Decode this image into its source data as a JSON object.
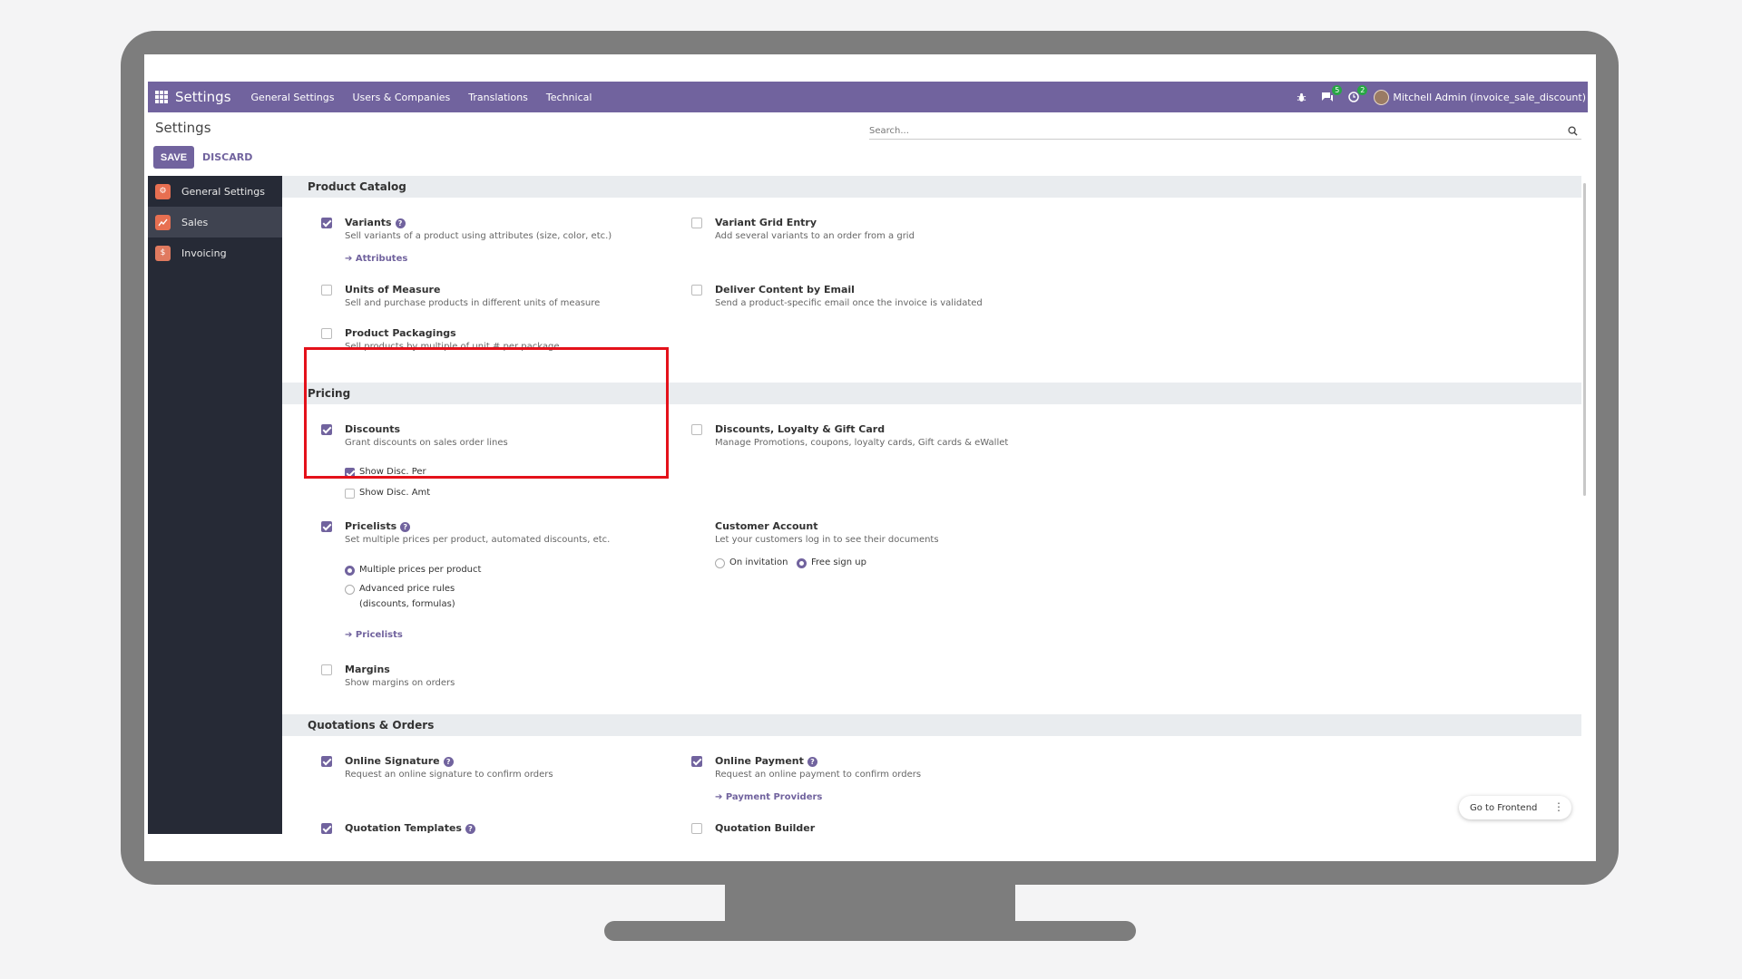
{
  "navbar": {
    "brand": "Settings",
    "items": [
      "General Settings",
      "Users & Companies",
      "Translations",
      "Technical"
    ],
    "messages_count": "5",
    "activities_count": "2",
    "user": "Mitchell Admin (invoice_sale_discount)"
  },
  "control_panel": {
    "title": "Settings",
    "save_label": "SAVE",
    "discard_label": "DISCARD",
    "search_placeholder": "Search..."
  },
  "sidebar": {
    "items": [
      {
        "label": "General Settings",
        "color": "#e76f51",
        "active": false
      },
      {
        "label": "Sales",
        "color": "#e76f51",
        "active": true
      },
      {
        "label": "Invoicing",
        "color": "#e07a5f",
        "active": false
      }
    ]
  },
  "sections": {
    "product_catalog": "Product Catalog",
    "pricing": "Pricing",
    "quotations_orders": "Quotations & Orders"
  },
  "settings": {
    "variants": {
      "title": "Variants",
      "desc": "Sell variants of a product using attributes (size, color, etc.)",
      "link": "Attributes",
      "checked": true
    },
    "variant_grid": {
      "title": "Variant Grid Entry",
      "desc": "Add several variants to an order from a grid",
      "checked": false
    },
    "uom": {
      "title": "Units of Measure",
      "desc": "Sell and purchase products in different units of measure",
      "checked": false
    },
    "deliver_content": {
      "title": "Deliver Content by Email",
      "desc": "Send a product-specific email once the invoice is validated",
      "checked": false
    },
    "packagings": {
      "title": "Product Packagings",
      "desc": "Sell products by multiple of unit # per package",
      "checked": false
    },
    "discounts": {
      "title": "Discounts",
      "desc": "Grant discounts on sales order lines",
      "checked": true,
      "show_disc_per": "Show Disc. Per",
      "show_disc_amt": "Show Disc. Amt"
    },
    "loyalty": {
      "title": "Discounts, Loyalty & Gift Card",
      "desc": "Manage Promotions, coupons, loyalty cards, Gift cards & eWallet",
      "checked": false
    },
    "pricelists": {
      "title": "Pricelists",
      "desc": "Set multiple prices per product, automated discounts, etc.",
      "checked": true,
      "option_multiple": "Multiple prices per product",
      "option_advanced": "Advanced price rules",
      "option_advanced_sub": "(discounts, formulas)",
      "link": "Pricelists"
    },
    "customer_account": {
      "title": "Customer Account",
      "desc": "Let your customers log in to see their documents",
      "option_invitation": "On invitation",
      "option_free": "Free sign up"
    },
    "margins": {
      "title": "Margins",
      "desc": "Show margins on orders",
      "checked": false
    },
    "online_signature": {
      "title": "Online Signature",
      "desc": "Request an online signature to confirm orders",
      "checked": true
    },
    "online_payment": {
      "title": "Online Payment",
      "desc": "Request an online payment to confirm orders",
      "link": "Payment Providers",
      "checked": true
    },
    "quotation_templates": {
      "title": "Quotation Templates",
      "checked": true
    },
    "quotation_builder": {
      "title": "Quotation Builder",
      "checked": false
    }
  },
  "go_frontend": "Go to Frontend",
  "accent_color": "#71639e",
  "highlight_color": "#e4111a"
}
